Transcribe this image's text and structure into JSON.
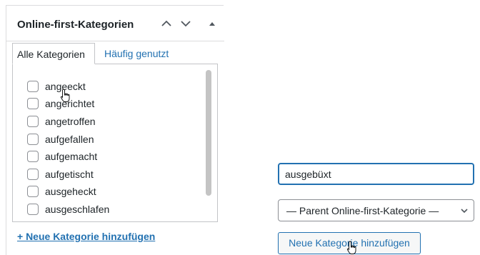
{
  "metabox": {
    "title": "Online-first-Kategorien"
  },
  "tabs": [
    {
      "label": "Alle Kategorien",
      "active": true
    },
    {
      "label": "Häufig genutzt",
      "active": false
    }
  ],
  "categories": [
    {
      "label": "angeeckt",
      "checked": false
    },
    {
      "label": "angerichtet",
      "checked": false
    },
    {
      "label": "angetroffen",
      "checked": false
    },
    {
      "label": "aufgefallen",
      "checked": false
    },
    {
      "label": "aufgemacht",
      "checked": false
    },
    {
      "label": "aufgetischt",
      "checked": false
    },
    {
      "label": "ausgeheckt",
      "checked": false
    },
    {
      "label": "ausgeschlafen",
      "checked": false
    }
  ],
  "add_link_label": "+ Neue Kategorie hinzufügen",
  "new_category": {
    "value": "ausgebüxt"
  },
  "parent_select": {
    "selected": "— Parent Online-first-Kategorie —"
  },
  "add_button_label": "Neue Kategorie hinzufügen",
  "colors": {
    "link": "#2271b1",
    "border": "#c3c4c7",
    "text": "#1d2327"
  }
}
